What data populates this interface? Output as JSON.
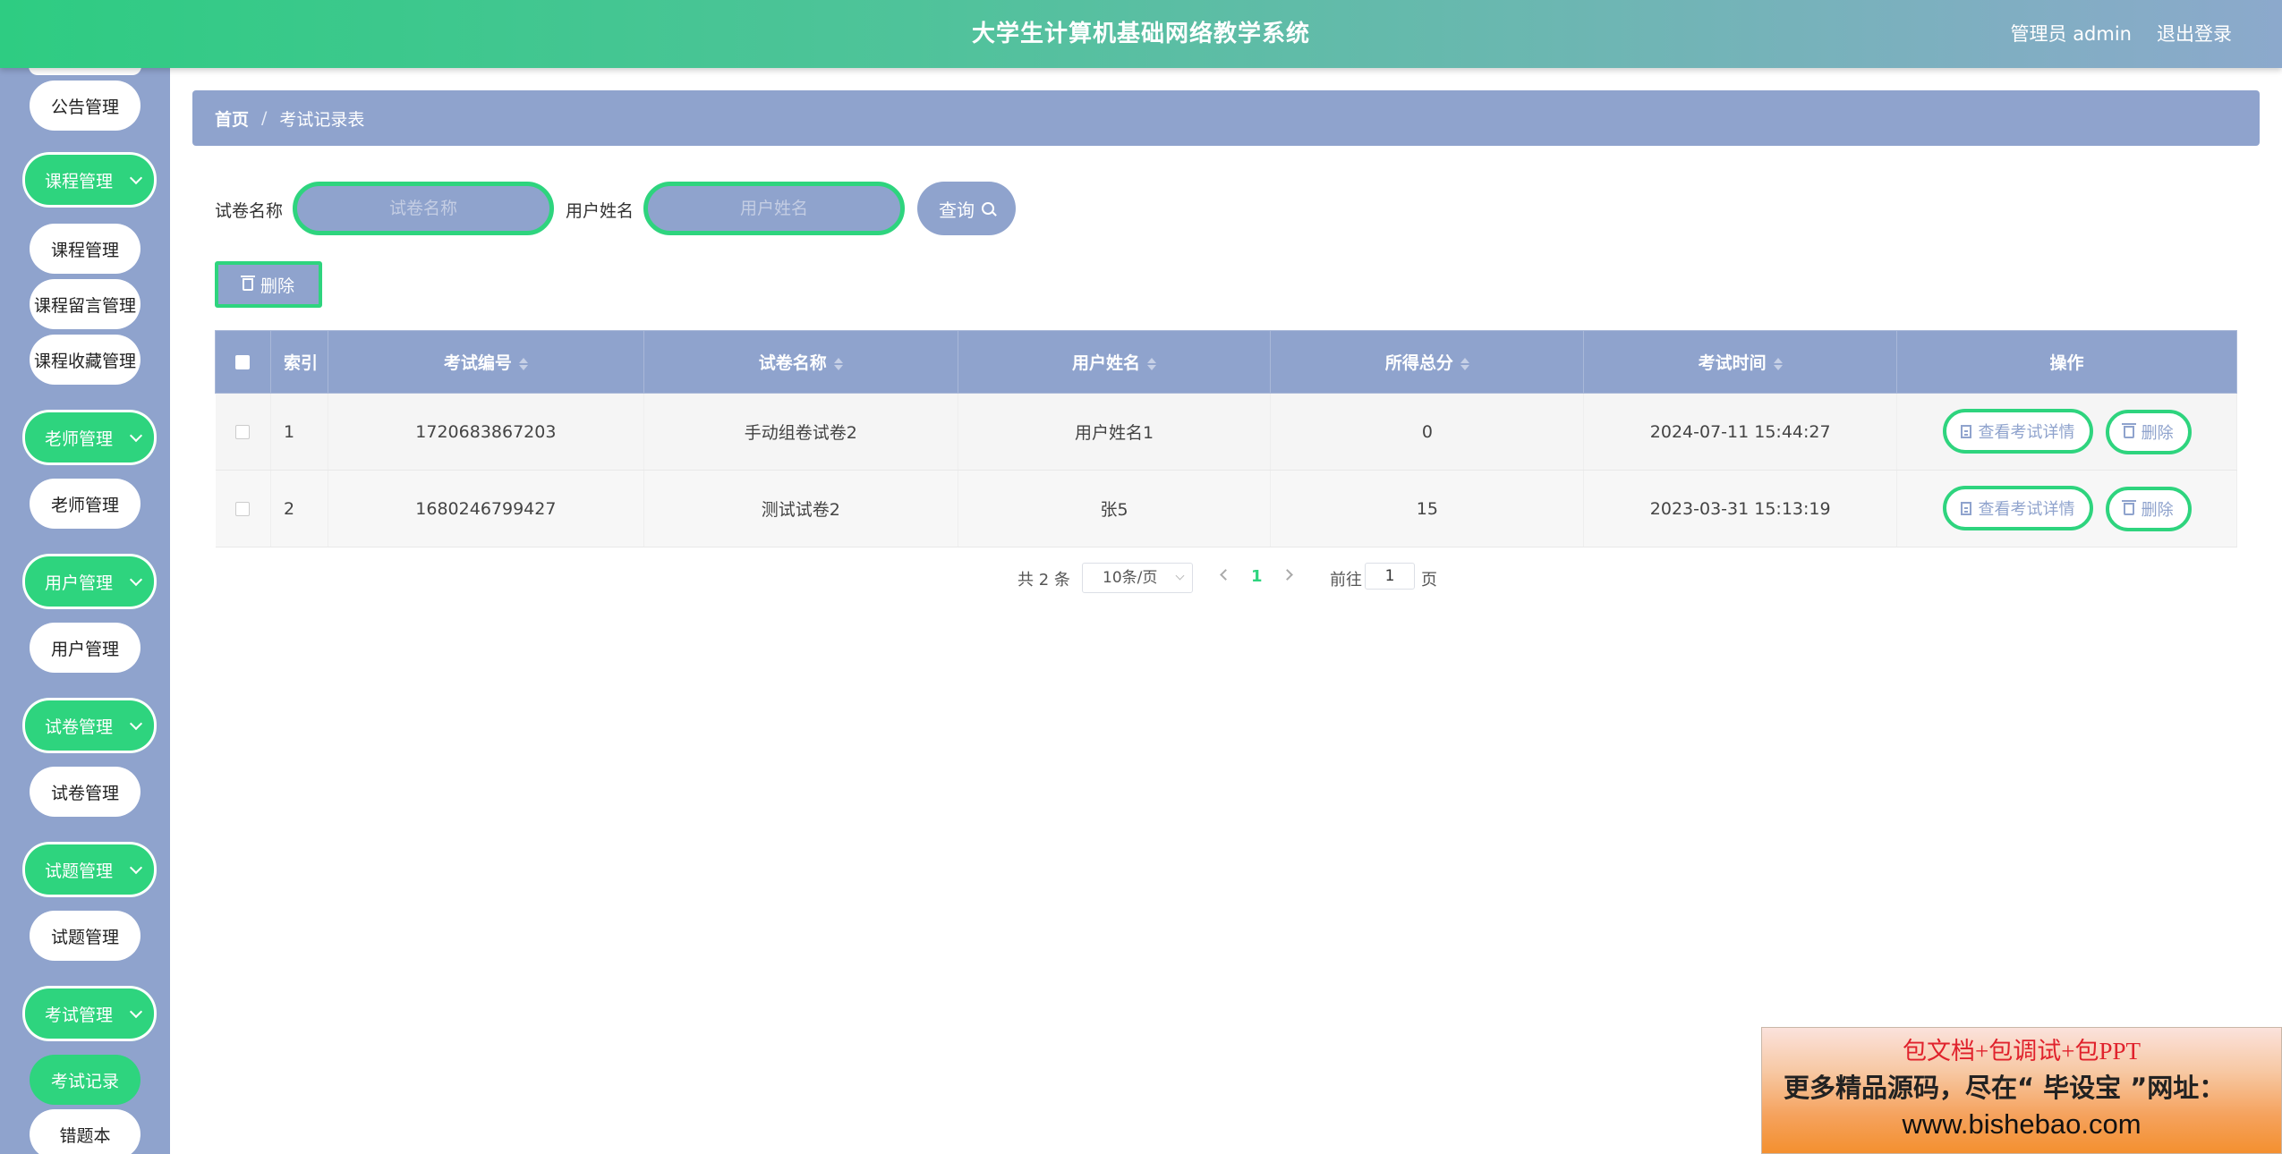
{
  "header": {
    "title": "大学生计算机基础网络教学系统",
    "admin_label": "管理员 admin",
    "logout_label": "退出登录"
  },
  "sidebar": {
    "items": [
      {
        "type": "sub",
        "label": "公告管理"
      },
      {
        "type": "group",
        "label": "课程管理"
      },
      {
        "type": "sub",
        "label": "课程管理"
      },
      {
        "type": "sub",
        "label": "课程留言管理"
      },
      {
        "type": "sub",
        "label": "课程收藏管理"
      },
      {
        "type": "group",
        "label": "老师管理"
      },
      {
        "type": "sub",
        "label": "老师管理"
      },
      {
        "type": "group",
        "label": "用户管理"
      },
      {
        "type": "sub",
        "label": "用户管理"
      },
      {
        "type": "group",
        "label": "试卷管理"
      },
      {
        "type": "sub",
        "label": "试卷管理"
      },
      {
        "type": "group",
        "label": "试题管理"
      },
      {
        "type": "sub",
        "label": "试题管理"
      },
      {
        "type": "group",
        "label": "考试管理"
      },
      {
        "type": "sub",
        "label": "考试记录",
        "active": true
      },
      {
        "type": "sub",
        "label": "错题本"
      }
    ]
  },
  "breadcrumb": {
    "home": "首页",
    "separator": "/",
    "current": "考试记录表"
  },
  "search": {
    "paper_label": "试卷名称",
    "paper_placeholder": "试卷名称",
    "user_label": "用户姓名",
    "user_placeholder": "用户姓名",
    "query_label": "查询"
  },
  "toolbar": {
    "delete_label": "删除"
  },
  "table": {
    "columns": [
      "索引",
      "考试编号",
      "试卷名称",
      "用户姓名",
      "所得总分",
      "考试时间",
      "操作"
    ],
    "rows": [
      {
        "index": "1",
        "exam_no": "1720683867203",
        "paper": "手动组卷试卷2",
        "user": "用户姓名1",
        "score": "0",
        "time": "2024-07-11 15:44:27"
      },
      {
        "index": "2",
        "exam_no": "1680246799427",
        "paper": "测试试卷2",
        "user": "张5",
        "score": "15",
        "time": "2023-03-31 15:13:19"
      }
    ],
    "detail_label": "查看考试详情",
    "row_delete_label": "删除"
  },
  "pagination": {
    "total": "共 2 条",
    "page_size": "10条/页",
    "current_page": "1",
    "goto_label": "前往",
    "goto_value": "1",
    "page_suffix": "页"
  },
  "ad": {
    "line1": "包文档+包调试+包PPT",
    "line2": "更多精品源码，尽在“ 毕设宝 ”网址：",
    "line3": "www.bishebao.com"
  },
  "colors": {
    "accent_green": "#2ed47e",
    "slate_blue": "#8fa3cd"
  }
}
